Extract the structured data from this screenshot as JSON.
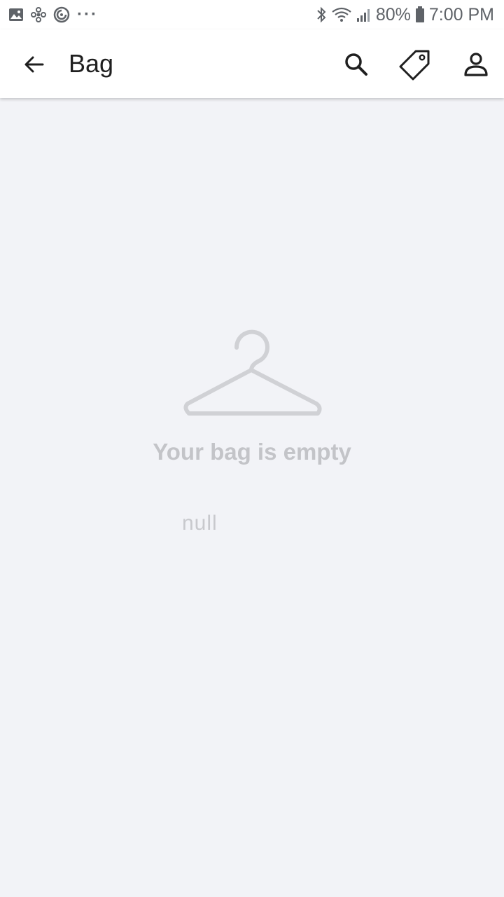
{
  "status_bar": {
    "battery": "80%",
    "time": "7:00 PM",
    "icons": [
      "image-icon",
      "pinwheel-icon",
      "sync-icon",
      "more-dots-icon",
      "bluetooth-icon",
      "wifi-icon",
      "signal-icon",
      "battery-icon"
    ]
  },
  "app_bar": {
    "title": "Bag",
    "icons": [
      "back-arrow-icon",
      "search-icon",
      "tag-icon",
      "account-icon"
    ]
  },
  "empty_state": {
    "icon": "hanger-icon",
    "message": "Your bag is empty",
    "sub_message": "null"
  },
  "colors": {
    "background": "#f2f3f7",
    "app_bar": "#ffffff",
    "muted_text": "#c3c4c8"
  }
}
